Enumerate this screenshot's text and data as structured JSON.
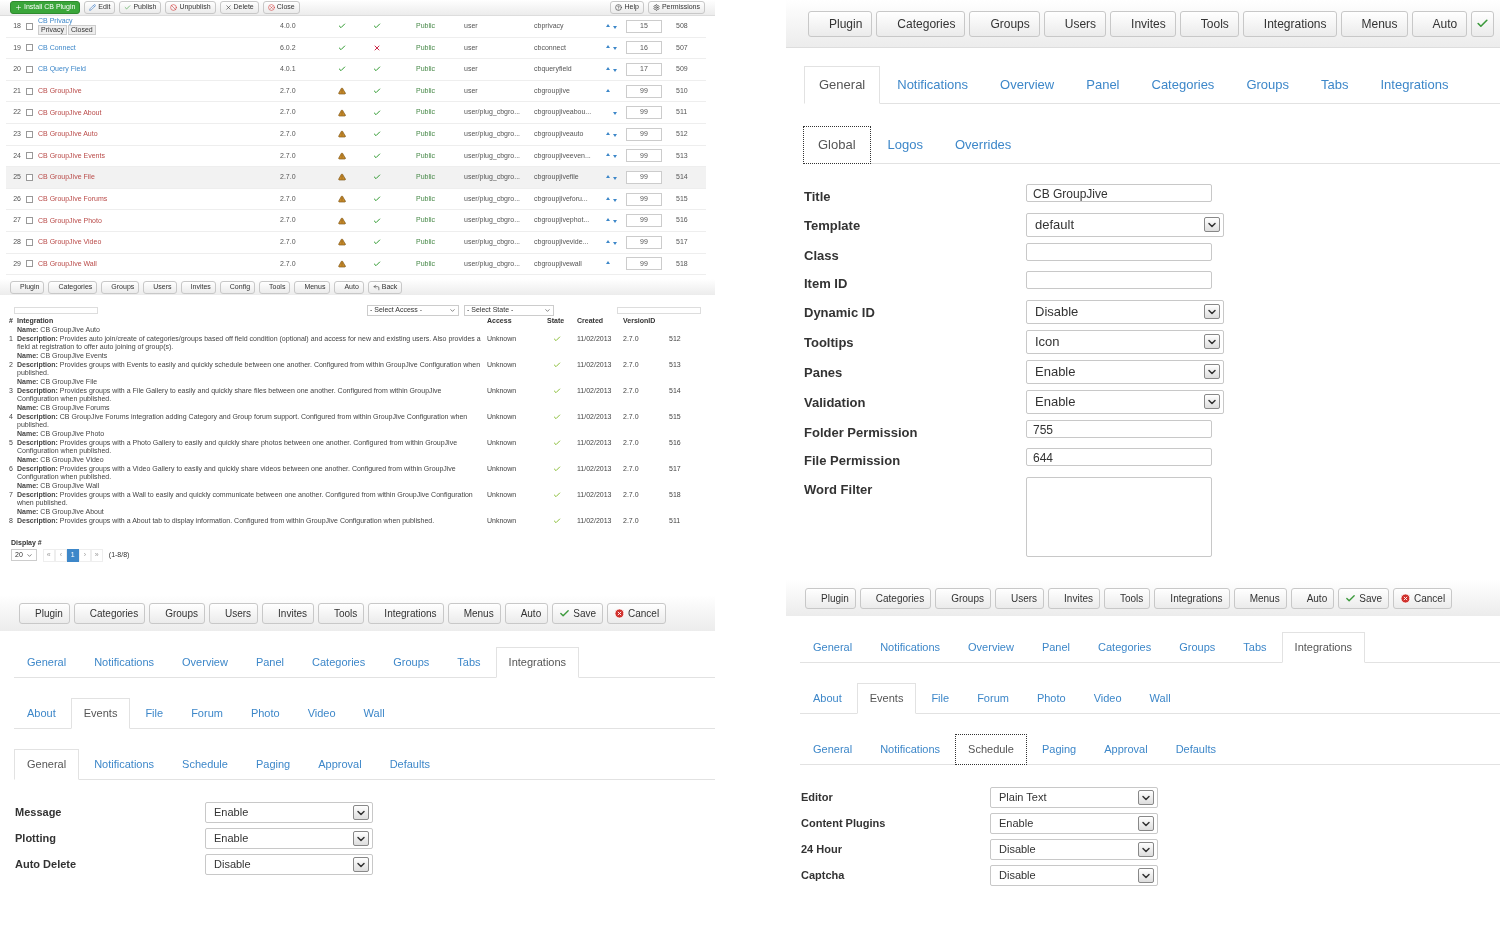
{
  "plugin_list": {
    "toolbar": {
      "left": [
        {
          "label": "Install CB Plugin",
          "kind": "install"
        },
        {
          "label": "Edit",
          "kind": "edit"
        },
        {
          "label": "Publish",
          "kind": "publish"
        },
        {
          "label": "Unpublish",
          "kind": "unpublish"
        },
        {
          "label": "Delete",
          "kind": "delete"
        },
        {
          "label": "Close",
          "kind": "close"
        }
      ],
      "right": [
        {
          "label": "Help",
          "kind": "help"
        },
        {
          "label": "Permissions",
          "kind": "permissions"
        }
      ]
    },
    "rows": [
      {
        "number": "18",
        "name": "CB Privacy",
        "actions": [
          "Privacy",
          "Closed"
        ],
        "version": "4.0.0",
        "compatible": true,
        "published": true,
        "access": "Public",
        "type": "user",
        "element": "cbprivacy",
        "move_up": true,
        "move_down": true,
        "order": "15",
        "id": "508",
        "hovered": false
      },
      {
        "number": "19",
        "name": "CB Connect",
        "version": "6.0.2",
        "compatible": true,
        "published": false,
        "access": "Public",
        "type": "user",
        "element": "cbconnect",
        "move_up": true,
        "move_down": true,
        "order": "16",
        "id": "507",
        "hovered": false
      },
      {
        "number": "20",
        "name": "CB Query Field",
        "version": "4.0.1",
        "compatible": true,
        "published": true,
        "access": "Public",
        "type": "user",
        "element": "cbqueryfield",
        "move_up": true,
        "move_down": true,
        "order": "17",
        "id": "509",
        "hovered": false
      },
      {
        "number": "21",
        "name": "CB GroupJive",
        "version": "2.7.0",
        "compatible": false,
        "published": true,
        "access": "Public",
        "type": "user",
        "element": "cbgroupjive",
        "move_up": true,
        "move_down": false,
        "order": "99",
        "id": "510",
        "hovered": false
      },
      {
        "number": "22",
        "name": "CB GroupJive About",
        "version": "2.7.0",
        "compatible": false,
        "published": true,
        "access": "Public",
        "type": "user/plug_cbgro...",
        "element": "cbgroupjiveabou...",
        "move_up": false,
        "move_down": true,
        "order": "99",
        "id": "511",
        "hovered": false
      },
      {
        "number": "23",
        "name": "CB GroupJive Auto",
        "version": "2.7.0",
        "compatible": false,
        "published": true,
        "access": "Public",
        "type": "user/plug_cbgro...",
        "element": "cbgroupjiveauto",
        "move_up": true,
        "move_down": true,
        "order": "99",
        "id": "512",
        "hovered": false
      },
      {
        "number": "24",
        "name": "CB GroupJive Events",
        "version": "2.7.0",
        "compatible": false,
        "published": true,
        "access": "Public",
        "type": "user/plug_cbgro...",
        "element": "cbgroupjiveeven...",
        "move_up": true,
        "move_down": true,
        "order": "99",
        "id": "513",
        "hovered": false
      },
      {
        "number": "25",
        "name": "CB GroupJive File",
        "version": "2.7.0",
        "compatible": false,
        "published": true,
        "access": "Public",
        "type": "user/plug_cbgro...",
        "element": "cbgroupjivefile",
        "move_up": true,
        "move_down": true,
        "order": "99",
        "id": "514",
        "hovered": true
      },
      {
        "number": "26",
        "name": "CB GroupJive Forums",
        "version": "2.7.0",
        "compatible": false,
        "published": true,
        "access": "Public",
        "type": "user/plug_cbgro...",
        "element": "cbgroupjiveforu...",
        "move_up": true,
        "move_down": true,
        "order": "99",
        "id": "515",
        "hovered": false
      },
      {
        "number": "27",
        "name": "CB GroupJive Photo",
        "version": "2.7.0",
        "compatible": false,
        "published": true,
        "access": "Public",
        "type": "user/plug_cbgro...",
        "element": "cbgroupjivephot...",
        "move_up": true,
        "move_down": true,
        "order": "99",
        "id": "516",
        "hovered": false
      },
      {
        "number": "28",
        "name": "CB GroupJive Video",
        "version": "2.7.0",
        "compatible": false,
        "published": true,
        "access": "Public",
        "type": "user/plug_cbgro...",
        "element": "cbgroupjivevide...",
        "move_up": true,
        "move_down": true,
        "order": "99",
        "id": "517",
        "hovered": false
      },
      {
        "number": "29",
        "name": "CB GroupJive Wall",
        "version": "2.7.0",
        "compatible": false,
        "published": true,
        "access": "Public",
        "type": "user/plug_cbgro...",
        "element": "cbgroupjivewall",
        "move_up": true,
        "move_down": false,
        "order": "99",
        "id": "518",
        "hovered": false
      }
    ],
    "toolbar2": [
      {
        "label": "Plugin",
        "kind": "plain"
      },
      {
        "label": "Categories",
        "kind": "plain"
      },
      {
        "label": "Groups",
        "kind": "plain"
      },
      {
        "label": "Users",
        "kind": "plain"
      },
      {
        "label": "Invites",
        "kind": "plain"
      },
      {
        "label": "Config",
        "kind": "plain"
      },
      {
        "label": "Tools",
        "kind": "plain"
      },
      {
        "label": "Menus",
        "kind": "plain"
      },
      {
        "label": "Auto",
        "kind": "plain"
      },
      {
        "label": "Back",
        "kind": "back"
      }
    ],
    "filters": {
      "access": "- Select Access -",
      "state": "- Select State -"
    },
    "columns": {
      "number": "#",
      "integration": "Integration",
      "access": "Access",
      "state": "State",
      "created": "Created",
      "version": "VersionID"
    },
    "integrations": [
      {
        "number": "1",
        "name": "**Name:** CB GroupJive Auto",
        "description": "**Description:** Provides auto join/create of categories/groups based off field condition (optional) and access for new and existing users. Also provides a field at registration to offer auto joining of group(s).",
        "access": "Unknown",
        "state": true,
        "created": "11/02/2013",
        "version": "2.7.0",
        "id": "512"
      },
      {
        "number": "2",
        "name": "**Name:** CB GroupJive Events",
        "description": "**Description:** Provides groups with Events to easily and quickly schedule between one another. Configured from within GroupJive Configuration when published.",
        "access": "Unknown",
        "state": true,
        "created": "11/02/2013",
        "version": "2.7.0",
        "id": "513"
      },
      {
        "number": "3",
        "name": "**Name:** CB GroupJive File",
        "description": "**Description:** Provides groups with a File Gallery to easily and quickly share files between one another. Configured from within GroupJive Configuration when published.",
        "access": "Unknown",
        "state": true,
        "created": "11/02/2013",
        "version": "2.7.0",
        "id": "514"
      },
      {
        "number": "4",
        "name": "**Name:** CB GroupJive Forums",
        "description": "**Description:** CB GroupJive Forums integration adding Category and Group forum support. Configured from within GroupJive Configuration when published.",
        "access": "Unknown",
        "state": true,
        "created": "11/02/2013",
        "version": "2.7.0",
        "id": "515"
      },
      {
        "number": "5",
        "name": "**Name:** CB GroupJive Photo",
        "description": "**Description:** Provides groups with a Photo Gallery to easily and quickly share photos between one another. Configured from within GroupJive Configuration when published.",
        "access": "Unknown",
        "state": true,
        "created": "11/02/2013",
        "version": "2.7.0",
        "id": "516"
      },
      {
        "number": "6",
        "name": "**Name:** CB GroupJive Video",
        "description": "**Description:** Provides groups with a Video Gallery to easily and quickly share videos between one another. Configured from within GroupJive Configuration when published.",
        "access": "Unknown",
        "state": true,
        "created": "11/02/2013",
        "version": "2.7.0",
        "id": "517"
      },
      {
        "number": "7",
        "name": "**Name:** CB GroupJive Wall",
        "description": "**Description:** Provides groups with a Wall to easily and quickly communicate between one another. Configured from within GroupJive Configuration when published.",
        "access": "Unknown",
        "state": true,
        "created": "11/02/2013",
        "version": "2.7.0",
        "id": "518"
      },
      {
        "number": "8",
        "name": "**Name:** CB GroupJive About",
        "description": "**Description:** Provides groups with a About tab to display information. Configured from within GroupJive Configuration when published.",
        "access": "Unknown",
        "state": true,
        "created": "11/02/2013",
        "version": "2.7.0",
        "id": "511"
      }
    ],
    "display_label": "Display #",
    "display_value": "20",
    "pages": [
      {
        "label": "«",
        "selected": false
      },
      {
        "label": "‹",
        "selected": false
      },
      {
        "label": "1",
        "selected": true
      },
      {
        "label": "›",
        "selected": false
      },
      {
        "label": "»",
        "selected": false
      }
    ],
    "page_info": "(1-8/8)"
  },
  "global_settings": {
    "toolbar": [
      {
        "label": "Plugin",
        "kind": "plain"
      },
      {
        "label": "Categories",
        "kind": "plain"
      },
      {
        "label": "Groups",
        "kind": "plain"
      },
      {
        "label": "Users",
        "kind": "plain"
      },
      {
        "label": "Invites",
        "kind": "plain"
      },
      {
        "label": "Tools",
        "kind": "plain"
      },
      {
        "label": "Integrations",
        "kind": "plain"
      },
      {
        "label": "Menus",
        "kind": "plain"
      },
      {
        "label": "Auto",
        "kind": "plain"
      },
      {
        "kind": "save_icon"
      }
    ],
    "tab_rows": [
      {
        "focused": false,
        "tabs": [
          {
            "label": "General",
            "selected": true
          },
          {
            "label": "Notifications",
            "selected": false
          },
          {
            "label": "Overview",
            "selected": false
          },
          {
            "label": "Panel",
            "selected": false
          },
          {
            "label": "Categories",
            "selected": false
          },
          {
            "label": "Groups",
            "selected": false
          },
          {
            "label": "Tabs",
            "selected": false
          },
          {
            "label": "Integrations",
            "selected": false
          }
        ]
      },
      {
        "focused": true,
        "tabs": [
          {
            "label": "Global",
            "selected": true
          },
          {
            "label": "Logos",
            "selected": false
          },
          {
            "label": "Overrides",
            "selected": false
          }
        ]
      }
    ],
    "fields": [
      {
        "label": "Title",
        "kind": "text",
        "value": "CB GroupJive"
      },
      {
        "label": "Template",
        "kind": "select",
        "value": "default"
      },
      {
        "label": "Class",
        "kind": "text"
      },
      {
        "label": "Item ID",
        "kind": "text"
      },
      {
        "label": "Dynamic ID",
        "kind": "select",
        "value": "Disable"
      },
      {
        "label": "Tooltips",
        "kind": "select",
        "value": "Icon"
      },
      {
        "label": "Panes",
        "kind": "select",
        "value": "Enable"
      },
      {
        "label": "Validation",
        "kind": "select",
        "value": "Enable"
      },
      {
        "label": "Folder Permission",
        "kind": "text",
        "value": "755"
      },
      {
        "label": "File Permission",
        "kind": "text",
        "value": "644"
      },
      {
        "label": "Word Filter",
        "kind": "textarea"
      }
    ]
  },
  "events_general": {
    "toolbar": [
      {
        "label": "Plugin",
        "kind": "plain"
      },
      {
        "label": "Categories",
        "kind": "plain"
      },
      {
        "label": "Groups",
        "kind": "plain"
      },
      {
        "label": "Users",
        "kind": "plain"
      },
      {
        "label": "Invites",
        "kind": "plain"
      },
      {
        "label": "Tools",
        "kind": "plain"
      },
      {
        "label": "Integrations",
        "kind": "plain"
      },
      {
        "label": "Menus",
        "kind": "plain"
      },
      {
        "label": "Auto",
        "kind": "plain"
      },
      {
        "label": "Save",
        "kind": "save"
      },
      {
        "label": "Cancel",
        "kind": "cancel"
      }
    ],
    "tab_rows": [
      {
        "focused": false,
        "tabs": [
          {
            "label": "General",
            "selected": false
          },
          {
            "label": "Notifications",
            "selected": false
          },
          {
            "label": "Overview",
            "selected": false
          },
          {
            "label": "Panel",
            "selected": false
          },
          {
            "label": "Categories",
            "selected": false
          },
          {
            "label": "Groups",
            "selected": false
          },
          {
            "label": "Tabs",
            "selected": false
          },
          {
            "label": "Integrations",
            "selected": true
          }
        ]
      },
      {
        "focused": false,
        "tabs": [
          {
            "label": "About",
            "selected": false
          },
          {
            "label": "Events",
            "selected": true
          },
          {
            "label": "File",
            "selected": false
          },
          {
            "label": "Forum",
            "selected": false
          },
          {
            "label": "Photo",
            "selected": false
          },
          {
            "label": "Video",
            "selected": false
          },
          {
            "label": "Wall",
            "selected": false
          }
        ]
      },
      {
        "focused": false,
        "tabs": [
          {
            "label": "General",
            "selected": true
          },
          {
            "label": "Notifications",
            "selected": false
          },
          {
            "label": "Schedule",
            "selected": false
          },
          {
            "label": "Paging",
            "selected": false
          },
          {
            "label": "Approval",
            "selected": false
          },
          {
            "label": "Defaults",
            "selected": false
          }
        ]
      }
    ],
    "fields": [
      {
        "label": "Message",
        "kind": "select",
        "value": "Enable"
      },
      {
        "label": "Plotting",
        "kind": "select",
        "value": "Enable"
      },
      {
        "label": "Auto Delete",
        "kind": "select",
        "value": "Disable"
      }
    ]
  },
  "events_schedule": {
    "toolbar": [
      {
        "label": "Plugin",
        "kind": "plain"
      },
      {
        "label": "Categories",
        "kind": "plain"
      },
      {
        "label": "Groups",
        "kind": "plain"
      },
      {
        "label": "Users",
        "kind": "plain"
      },
      {
        "label": "Invites",
        "kind": "plain"
      },
      {
        "label": "Tools",
        "kind": "plain"
      },
      {
        "label": "Integrations",
        "kind": "plain"
      },
      {
        "label": "Menus",
        "kind": "plain"
      },
      {
        "label": "Auto",
        "kind": "plain"
      },
      {
        "label": "Save",
        "kind": "save"
      },
      {
        "label": "Cancel",
        "kind": "cancel"
      }
    ],
    "tab_rows": [
      {
        "focused": false,
        "tabs": [
          {
            "label": "General",
            "selected": false
          },
          {
            "label": "Notifications",
            "selected": false
          },
          {
            "label": "Overview",
            "selected": false
          },
          {
            "label": "Panel",
            "selected": false
          },
          {
            "label": "Categories",
            "selected": false
          },
          {
            "label": "Groups",
            "selected": false
          },
          {
            "label": "Tabs",
            "selected": false
          },
          {
            "label": "Integrations",
            "selected": true
          }
        ]
      },
      {
        "focused": false,
        "tabs": [
          {
            "label": "About",
            "selected": false
          },
          {
            "label": "Events",
            "selected": true
          },
          {
            "label": "File",
            "selected": false
          },
          {
            "label": "Forum",
            "selected": false
          },
          {
            "label": "Photo",
            "selected": false
          },
          {
            "label": "Video",
            "selected": false
          },
          {
            "label": "Wall",
            "selected": false
          }
        ]
      },
      {
        "focused": true,
        "tabs": [
          {
            "label": "General",
            "selected": false
          },
          {
            "label": "Notifications",
            "selected": false
          },
          {
            "label": "Schedule",
            "selected": true
          },
          {
            "label": "Paging",
            "selected": false
          },
          {
            "label": "Approval",
            "selected": false
          },
          {
            "label": "Defaults",
            "selected": false
          }
        ]
      }
    ],
    "fields": [
      {
        "label": "Editor",
        "kind": "select",
        "value": "Plain Text"
      },
      {
        "label": "Content Plugins",
        "kind": "select",
        "value": "Enable"
      },
      {
        "label": "24 Hour",
        "kind": "select",
        "value": "Disable"
      },
      {
        "label": "Captcha",
        "kind": "select",
        "value": "Disable"
      }
    ]
  }
}
